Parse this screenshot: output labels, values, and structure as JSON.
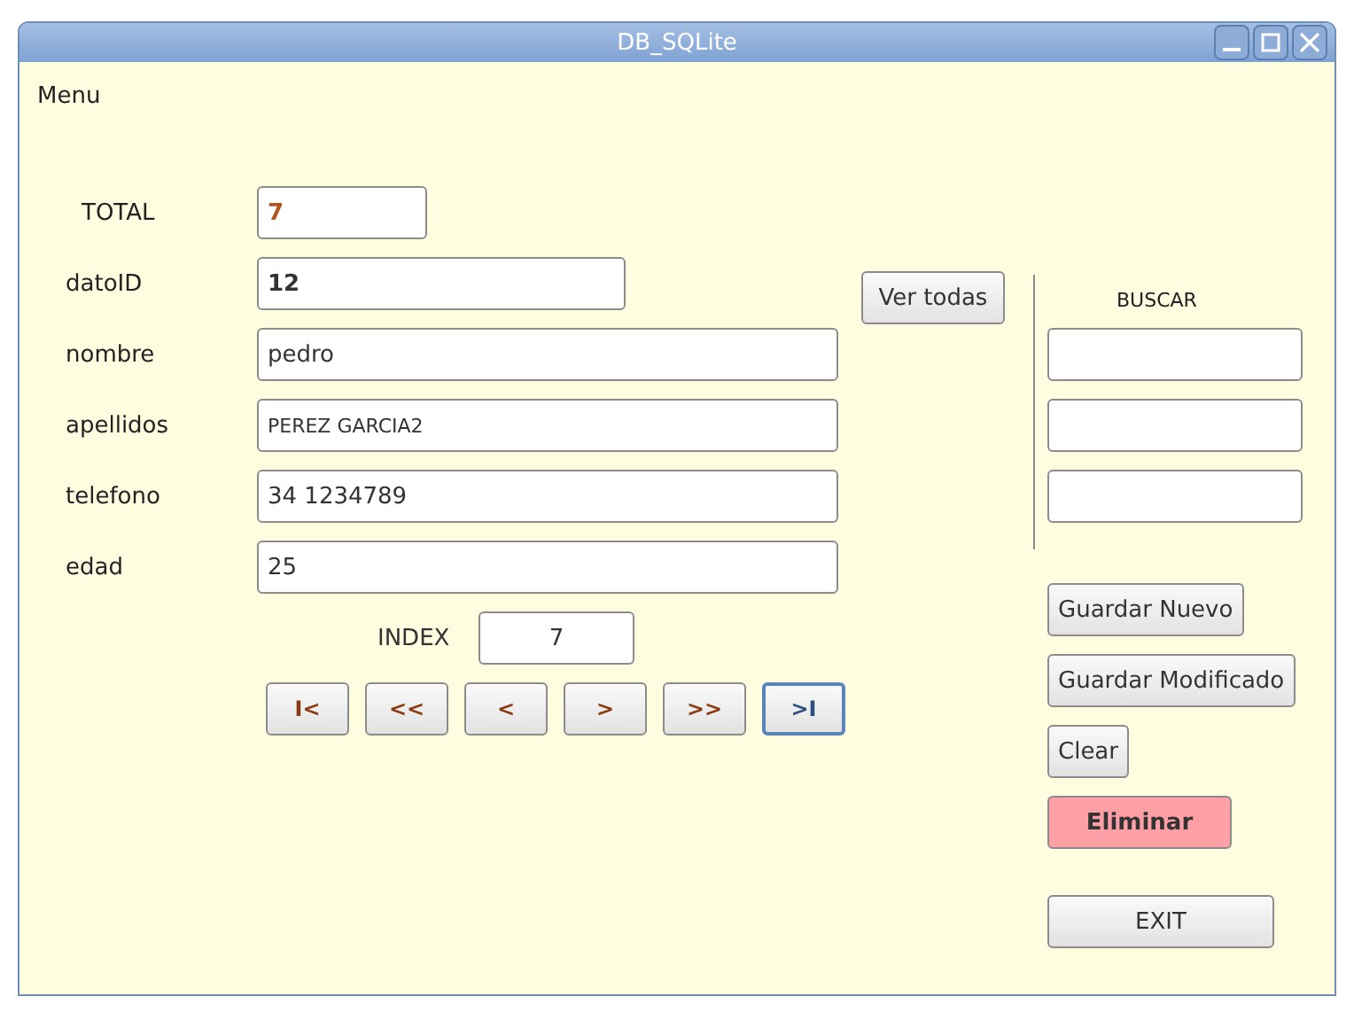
{
  "window": {
    "title": "DB_SQLite"
  },
  "menu": [
    "Menu"
  ],
  "total": {
    "label": "TOTAL",
    "value": "7"
  },
  "fields": [
    {
      "label": "datoID",
      "value": "12",
      "kind": "id"
    },
    {
      "label": "nombre",
      "value": "pedro",
      "kind": "text"
    },
    {
      "label": "apellidos",
      "value": "PEREZ GARCIA2",
      "kind": "small"
    },
    {
      "label": "telefono",
      "value": "34 1234789",
      "kind": "text"
    },
    {
      "label": "edad",
      "value": "25",
      "kind": "text"
    }
  ],
  "index": {
    "label": "INDEX",
    "value": "7"
  },
  "nav_buttons": [
    {
      "label": "I<",
      "selected": false
    },
    {
      "label": "<<",
      "selected": false
    },
    {
      "label": "<",
      "selected": false
    },
    {
      "label": ">",
      "selected": false
    },
    {
      "label": ">>",
      "selected": false
    },
    {
      "label": ">I",
      "selected": true
    }
  ],
  "view_all_button": "Ver todas",
  "search": {
    "label": "BUSCAR",
    "fields": [
      {
        "kind": "text"
      },
      {
        "kind": "text"
      },
      {
        "kind": "text"
      }
    ]
  },
  "actions": [
    {
      "label": "Guardar Nuevo",
      "kind": "normal"
    },
    {
      "label": "Guardar Modificado",
      "kind": "normal"
    },
    {
      "label": "Clear",
      "kind": "normal"
    },
    {
      "label": "Eliminar",
      "kind": "danger"
    },
    {
      "label": "EXIT",
      "kind": "exit"
    }
  ]
}
